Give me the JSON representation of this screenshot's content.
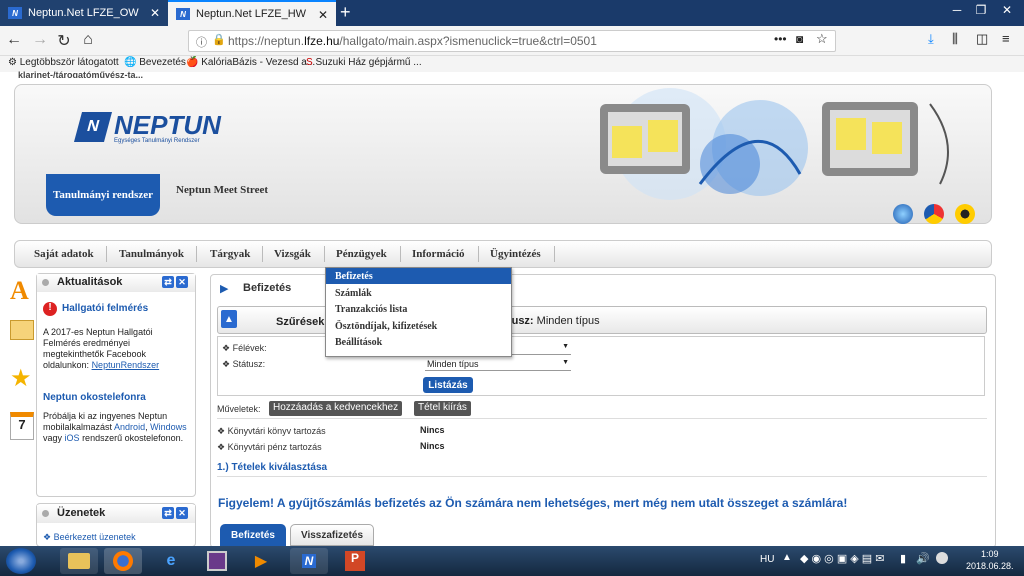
{
  "browser": {
    "tabs": [
      {
        "label": "Neptun.Net LFZE_OW",
        "fav": "N"
      },
      {
        "label": "Neptun.Net LFZE_HW",
        "fav": "N"
      }
    ],
    "url_prefix": "https://neptun.",
    "url_domain": "lfze.hu",
    "url_path": "/hallgato/main.aspx?ismenuclick=true&ctrl=0501",
    "bookmarks": [
      "Legtöbbször látogatott",
      "Bevezetés",
      "KalóriaBázis - Vezesd a...",
      "Suzuki Ház gépjármű ..."
    ],
    "partial_text": "klarinet-/tárogatóművész-ta..."
  },
  "header": {
    "logo_letter": "N",
    "logo": "NEPTUN",
    "logo_sub": "Egységes Tanulmányi Rendszer",
    "sys_tab": "Tanulmányi rendszer",
    "meet": "Neptun Meet Street"
  },
  "menu": [
    "Saját adatok",
    "Tanulmányok",
    "Tárgyak",
    "Vizsgák",
    "Pénzügyek",
    "Információ",
    "Ügyintézés"
  ],
  "dropdown": [
    "Befizetés",
    "Számlák",
    "Tranzakciós lista",
    "Ösztöndíjak, kifizetések",
    "Beállítások"
  ],
  "sidebar": {
    "news_title": "Aktualitások",
    "survey_title": "Hallgatói felmérés",
    "survey_text": "A 2017-es Neptun Hallgatói Felmérés eredményei megtekinthetők Facebook oldalunkon:",
    "survey_link": "NeptunRendszer",
    "mobile_title": "Neptun okostelefonra",
    "mobile_text1": "Próbálja ki az ingyenes Neptun mobilalkalmazást",
    "android": "Android",
    "mobile_text2": ",",
    "windows": "Windows",
    "vagy": "vagy",
    "ios": "iOS",
    "mobile_text3": "rendszerű okostelefonon.",
    "messages_title": "Üzenetek",
    "inbox": "Beérkezett üzenetek",
    "cal_num": "7"
  },
  "main": {
    "title": "Befizetés",
    "filter_label": "Szűrések",
    "filter_summary_end": "v,",
    "status_label": "Státusz:",
    "status_value": "Minden típus",
    "felevek": "Félévek:",
    "statusz": "Státusz:",
    "status_select": "Minden típus",
    "list_btn": "Listázás",
    "muveletek": "Műveletek:",
    "add_fav": "Hozzáadás a kedvencekhez",
    "print": "Tétel kiírás",
    "book_debt_label": "Könyvtári könyv tartozás",
    "book_debt_val": "Nincs",
    "money_debt_label": "Könyvtári pénz tartozás",
    "money_debt_val": "Nincs",
    "section": "1.) Tételek kiválasztása",
    "warning": "Figyelem! A gyűjtőszámlás befizetés az Ön számára nem lehetséges, mert még nem utalt összeget a számlára!",
    "tab_pay": "Befizetés",
    "tab_refund": "Visszafizetés"
  },
  "taskbar": {
    "lang": "HU",
    "time": "1:09",
    "date": "2018.06.28."
  },
  "colors": {
    "neptun_blue": "#1d5bb0",
    "tabbar": "#1a3a6a"
  }
}
